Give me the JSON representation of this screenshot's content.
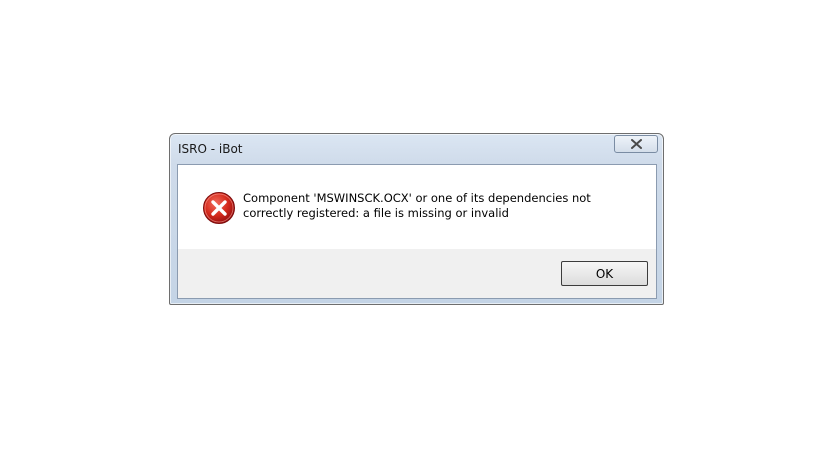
{
  "window": {
    "title": "ISRO - iBot",
    "close_icon": "close-icon"
  },
  "message": {
    "icon": "error-icon",
    "text": "Component 'MSWINSCK.OCX' or one of its dependencies not correctly registered: a file is missing or invalid"
  },
  "buttons": {
    "ok_label": "OK"
  },
  "colors": {
    "error_red": "#c41e1e",
    "titlebar": "#cfdbea",
    "footer": "#f0f0f0"
  }
}
